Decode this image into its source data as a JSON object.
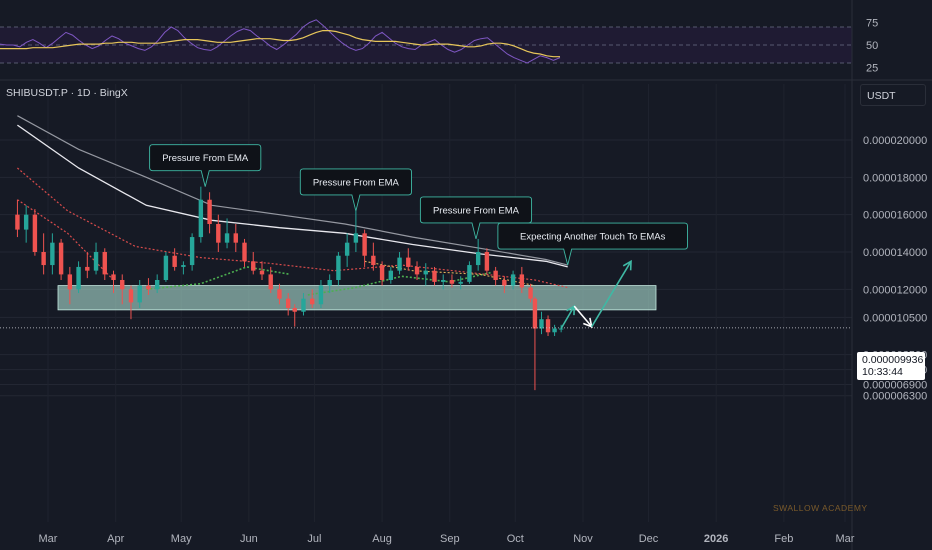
{
  "chart_data": [
    {
      "type": "line",
      "title": "",
      "y_ticks": [
        75,
        50,
        25
      ],
      "ylim": [
        20,
        80
      ],
      "bands": {
        "upper": 70,
        "middle": 50,
        "lower": 30
      },
      "series": [
        {
          "values": [
            51,
            50,
            50,
            48,
            53,
            56,
            52,
            47,
            52,
            58,
            64,
            61,
            55,
            50,
            46,
            49,
            55,
            60,
            57,
            52,
            49,
            46,
            44,
            48,
            55,
            64,
            70,
            66,
            58,
            52,
            47,
            45,
            44,
            48,
            54,
            60,
            65,
            68,
            66,
            60,
            55,
            49,
            45,
            50,
            56,
            62,
            70,
            75,
            78,
            72,
            65,
            58,
            52,
            47,
            44,
            46,
            52,
            60,
            64,
            58,
            52,
            48,
            46,
            45,
            50,
            53,
            56,
            50,
            45,
            42,
            45,
            50,
            55,
            57,
            58,
            52,
            46,
            40,
            36,
            33,
            30,
            34,
            38,
            36,
            33,
            36
          ]
        },
        {
          "values": [
            46,
            46,
            46,
            46,
            46,
            47,
            47,
            47,
            47,
            48,
            49,
            50,
            51,
            51,
            51,
            51,
            52,
            52,
            53,
            53,
            53,
            52,
            52,
            52,
            52,
            53,
            54,
            55,
            56,
            56,
            56,
            55,
            54,
            53,
            53,
            53,
            54,
            55,
            56,
            57,
            57,
            57,
            56,
            55,
            55,
            56,
            58,
            61,
            64,
            66,
            66,
            65,
            63,
            61,
            58,
            56,
            55,
            54,
            54,
            54,
            54,
            53,
            52,
            51,
            50,
            50,
            51,
            51,
            51,
            50,
            49,
            48,
            48,
            49,
            51,
            52,
            52,
            51,
            49,
            46,
            43,
            41,
            40,
            38,
            37,
            37
          ]
        }
      ]
    },
    {
      "type": "candlestick",
      "title": "",
      "y_ticks": [
        "0.000020000",
        "0.000018000",
        "0.000016000",
        "0.000014000",
        "0.000012000",
        "0.000010500",
        "0.000008500",
        "0.000007700",
        "0.000006900",
        "0.000006300"
      ],
      "x_ticks": [
        "Mar",
        "Apr",
        "May",
        "Jun",
        "Jul",
        "Aug",
        "Sep",
        "Oct",
        "Nov",
        "Dec",
        "2026",
        "Feb",
        "Mar"
      ],
      "zone": [
        1.09e-05,
        1.22e-05
      ],
      "last_price": "0.000009936",
      "countdown": "10:33:44",
      "ohlc": [
        {
          "date": "2025-02-15",
          "o": 1.6e-05,
          "h": 1.68e-05,
          "l": 1.48e-05,
          "c": 1.52e-05
        },
        {
          "date": "2025-02-19",
          "o": 1.52e-05,
          "h": 1.65e-05,
          "l": 1.45e-05,
          "c": 1.6e-05
        },
        {
          "date": "2025-02-23",
          "o": 1.6e-05,
          "h": 1.63e-05,
          "l": 1.38e-05,
          "c": 1.4e-05
        },
        {
          "date": "2025-02-27",
          "o": 1.4e-05,
          "h": 1.5e-05,
          "l": 1.28e-05,
          "c": 1.33e-05
        },
        {
          "date": "2025-03-03",
          "o": 1.33e-05,
          "h": 1.5e-05,
          "l": 1.28e-05,
          "c": 1.45e-05
        },
        {
          "date": "2025-03-07",
          "o": 1.45e-05,
          "h": 1.47e-05,
          "l": 1.25e-05,
          "c": 1.28e-05
        },
        {
          "date": "2025-03-11",
          "o": 1.28e-05,
          "h": 1.32e-05,
          "l": 1.12e-05,
          "c": 1.2e-05
        },
        {
          "date": "2025-03-15",
          "o": 1.2e-05,
          "h": 1.35e-05,
          "l": 1.18e-05,
          "c": 1.32e-05
        },
        {
          "date": "2025-03-19",
          "o": 1.32e-05,
          "h": 1.4e-05,
          "l": 1.26e-05,
          "c": 1.3e-05
        },
        {
          "date": "2025-03-23",
          "o": 1.3e-05,
          "h": 1.45e-05,
          "l": 1.28e-05,
          "c": 1.4e-05
        },
        {
          "date": "2025-03-27",
          "o": 1.4e-05,
          "h": 1.42e-05,
          "l": 1.25e-05,
          "c": 1.28e-05
        },
        {
          "date": "2025-03-31",
          "o": 1.28e-05,
          "h": 1.3e-05,
          "l": 1.18e-05,
          "c": 1.25e-05
        },
        {
          "date": "2025-04-04",
          "o": 1.25e-05,
          "h": 1.28e-05,
          "l": 1.12e-05,
          "c": 1.2e-05
        },
        {
          "date": "2025-04-08",
          "o": 1.2e-05,
          "h": 1.22e-05,
          "l": 1.04e-05,
          "c": 1.13e-05
        },
        {
          "date": "2025-04-12",
          "o": 1.13e-05,
          "h": 1.25e-05,
          "l": 1.1e-05,
          "c": 1.22e-05
        },
        {
          "date": "2025-04-16",
          "o": 1.22e-05,
          "h": 1.26e-05,
          "l": 1.17e-05,
          "c": 1.2e-05
        },
        {
          "date": "2025-04-20",
          "o": 1.2e-05,
          "h": 1.28e-05,
          "l": 1.18e-05,
          "c": 1.25e-05
        },
        {
          "date": "2025-04-24",
          "o": 1.25e-05,
          "h": 1.4e-05,
          "l": 1.24e-05,
          "c": 1.38e-05
        },
        {
          "date": "2025-04-28",
          "o": 1.38e-05,
          "h": 1.42e-05,
          "l": 1.3e-05,
          "c": 1.32e-05
        },
        {
          "date": "2025-05-02",
          "o": 1.32e-05,
          "h": 1.35e-05,
          "l": 1.28e-05,
          "c": 1.33e-05
        },
        {
          "date": "2025-05-06",
          "o": 1.33e-05,
          "h": 1.5e-05,
          "l": 1.3e-05,
          "c": 1.48e-05
        },
        {
          "date": "2025-05-10",
          "o": 1.48e-05,
          "h": 1.75e-05,
          "l": 1.45e-05,
          "c": 1.68e-05
        },
        {
          "date": "2025-05-14",
          "o": 1.68e-05,
          "h": 1.72e-05,
          "l": 1.5e-05,
          "c": 1.55e-05
        },
        {
          "date": "2025-05-18",
          "o": 1.55e-05,
          "h": 1.6e-05,
          "l": 1.4e-05,
          "c": 1.45e-05
        },
        {
          "date": "2025-05-22",
          "o": 1.45e-05,
          "h": 1.58e-05,
          "l": 1.42e-05,
          "c": 1.5e-05
        },
        {
          "date": "2025-05-26",
          "o": 1.5e-05,
          "h": 1.55e-05,
          "l": 1.4e-05,
          "c": 1.45e-05
        },
        {
          "date": "2025-05-30",
          "o": 1.45e-05,
          "h": 1.47e-05,
          "l": 1.32e-05,
          "c": 1.35e-05
        },
        {
          "date": "2025-06-03",
          "o": 1.35e-05,
          "h": 1.4e-05,
          "l": 1.28e-05,
          "c": 1.3e-05
        },
        {
          "date": "2025-06-07",
          "o": 1.3e-05,
          "h": 1.35e-05,
          "l": 1.25e-05,
          "c": 1.28e-05
        },
        {
          "date": "2025-06-11",
          "o": 1.28e-05,
          "h": 1.32e-05,
          "l": 1.18e-05,
          "c": 1.2e-05
        },
        {
          "date": "2025-06-15",
          "o": 1.2e-05,
          "h": 1.23e-05,
          "l": 1.12e-05,
          "c": 1.15e-05
        },
        {
          "date": "2025-06-19",
          "o": 1.15e-05,
          "h": 1.18e-05,
          "l": 1.06e-05,
          "c": 1.1e-05
        },
        {
          "date": "2025-06-22",
          "o": 1.1e-05,
          "h": 1.12e-05,
          "l": 1e-05,
          "c": 1.08e-05
        },
        {
          "date": "2025-06-26",
          "o": 1.08e-05,
          "h": 1.18e-05,
          "l": 1.06e-05,
          "c": 1.15e-05
        },
        {
          "date": "2025-06-30",
          "o": 1.15e-05,
          "h": 1.2e-05,
          "l": 1.1e-05,
          "c": 1.12e-05
        },
        {
          "date": "2025-07-04",
          "o": 1.12e-05,
          "h": 1.25e-05,
          "l": 1.1e-05,
          "c": 1.22e-05
        },
        {
          "date": "2025-07-08",
          "o": 1.22e-05,
          "h": 1.28e-05,
          "l": 1.18e-05,
          "c": 1.25e-05
        },
        {
          "date": "2025-07-12",
          "o": 1.25e-05,
          "h": 1.4e-05,
          "l": 1.22e-05,
          "c": 1.38e-05
        },
        {
          "date": "2025-07-16",
          "o": 1.38e-05,
          "h": 1.5e-05,
          "l": 1.32e-05,
          "c": 1.45e-05
        },
        {
          "date": "2025-07-20",
          "o": 1.45e-05,
          "h": 1.62e-05,
          "l": 1.4e-05,
          "c": 1.5e-05
        },
        {
          "date": "2025-07-24",
          "o": 1.5e-05,
          "h": 1.52e-05,
          "l": 1.32e-05,
          "c": 1.38e-05
        },
        {
          "date": "2025-07-28",
          "o": 1.38e-05,
          "h": 1.45e-05,
          "l": 1.3e-05,
          "c": 1.33e-05
        },
        {
          "date": "2025-08-01",
          "o": 1.33e-05,
          "h": 1.35e-05,
          "l": 1.22e-05,
          "c": 1.25e-05
        },
        {
          "date": "2025-08-05",
          "o": 1.25e-05,
          "h": 1.32e-05,
          "l": 1.23e-05,
          "c": 1.3e-05
        },
        {
          "date": "2025-08-09",
          "o": 1.3e-05,
          "h": 1.4e-05,
          "l": 1.28e-05,
          "c": 1.37e-05
        },
        {
          "date": "2025-08-13",
          "o": 1.37e-05,
          "h": 1.42e-05,
          "l": 1.3e-05,
          "c": 1.32e-05
        },
        {
          "date": "2025-08-17",
          "o": 1.32e-05,
          "h": 1.35e-05,
          "l": 1.25e-05,
          "c": 1.28e-05
        },
        {
          "date": "2025-08-21",
          "o": 1.28e-05,
          "h": 1.34e-05,
          "l": 1.22e-05,
          "c": 1.3e-05
        },
        {
          "date": "2025-08-25",
          "o": 1.3e-05,
          "h": 1.32e-05,
          "l": 1.22e-05,
          "c": 1.24e-05
        },
        {
          "date": "2025-08-29",
          "o": 1.24e-05,
          "h": 1.28e-05,
          "l": 1.2e-05,
          "c": 1.25e-05
        },
        {
          "date": "2025-09-02",
          "o": 1.25e-05,
          "h": 1.28e-05,
          "l": 1.21e-05,
          "c": 1.23e-05
        },
        {
          "date": "2025-09-06",
          "o": 1.23e-05,
          "h": 1.27e-05,
          "l": 1.2e-05,
          "c": 1.24e-05
        },
        {
          "date": "2025-09-10",
          "o": 1.24e-05,
          "h": 1.35e-05,
          "l": 1.23e-05,
          "c": 1.33e-05
        },
        {
          "date": "2025-09-14",
          "o": 1.33e-05,
          "h": 1.47e-05,
          "l": 1.3e-05,
          "c": 1.4e-05
        },
        {
          "date": "2025-09-18",
          "o": 1.4e-05,
          "h": 1.42e-05,
          "l": 1.28e-05,
          "c": 1.3e-05
        },
        {
          "date": "2025-09-22",
          "o": 1.3e-05,
          "h": 1.32e-05,
          "l": 1.22e-05,
          "c": 1.25e-05
        },
        {
          "date": "2025-09-26",
          "o": 1.25e-05,
          "h": 1.27e-05,
          "l": 1.18e-05,
          "c": 1.22e-05
        },
        {
          "date": "2025-09-30",
          "o": 1.22e-05,
          "h": 1.3e-05,
          "l": 1.2e-05,
          "c": 1.28e-05
        },
        {
          "date": "2025-10-04",
          "o": 1.28e-05,
          "h": 1.32e-05,
          "l": 1.18e-05,
          "c": 1.21e-05
        },
        {
          "date": "2025-10-08",
          "o": 1.21e-05,
          "h": 1.23e-05,
          "l": 1.13e-05,
          "c": 1.15e-05
        },
        {
          "date": "2025-10-10",
          "o": 1.15e-05,
          "h": 1.16e-05,
          "l": 6.6e-06,
          "c": 9.9e-06
        },
        {
          "date": "2025-10-13",
          "o": 9.9e-06,
          "h": 1.08e-05,
          "l": 9.6e-06,
          "c": 1.04e-05
        },
        {
          "date": "2025-10-16",
          "o": 1.04e-05,
          "h": 1.06e-05,
          "l": 9.5e-06,
          "c": 9.7e-06
        },
        {
          "date": "2025-10-19",
          "o": 9.7e-06,
          "h": 1.01e-05,
          "l": 9.5e-06,
          "c": 9.9e-06
        },
        {
          "date": "2025-10-22",
          "o": 9.9e-06,
          "h": 1.01e-05,
          "l": 9.7e-06,
          "c": 9.9e-06
        }
      ],
      "series": [
        {
          "type": "line",
          "values": [
            {
              "x": "2025-02-15",
              "y": 2.13e-05
            },
            {
              "x": "2025-03-15",
              "y": 1.95e-05
            },
            {
              "x": "2025-04-15",
              "y": 1.8e-05
            },
            {
              "x": "2025-05-15",
              "y": 1.65e-05
            },
            {
              "x": "2025-06-15",
              "y": 1.6e-05
            },
            {
              "x": "2025-07-15",
              "y": 1.55e-05
            },
            {
              "x": "2025-08-15",
              "y": 1.48e-05
            },
            {
              "x": "2025-09-15",
              "y": 1.42e-05
            },
            {
              "x": "2025-10-15",
              "y": 1.36e-05
            },
            {
              "x": "2025-10-25",
              "y": 1.33e-05
            }
          ]
        },
        {
          "type": "line",
          "values": [
            {
              "x": "2025-02-15",
              "y": 2.08e-05
            },
            {
              "x": "2025-03-15",
              "y": 1.85e-05
            },
            {
              "x": "2025-04-15",
              "y": 1.65e-05
            },
            {
              "x": "2025-05-15",
              "y": 1.57e-05
            },
            {
              "x": "2025-06-15",
              "y": 1.53e-05
            },
            {
              "x": "2025-07-15",
              "y": 1.5e-05
            },
            {
              "x": "2025-08-15",
              "y": 1.44e-05
            },
            {
              "x": "2025-09-15",
              "y": 1.39e-05
            },
            {
              "x": "2025-10-15",
              "y": 1.35e-05
            },
            {
              "x": "2025-10-25",
              "y": 1.32e-05
            }
          ]
        },
        {
          "type": "line",
          "values": [
            {
              "x": "2025-02-15",
              "y": 1.85e-05
            },
            {
              "x": "2025-03-10",
              "y": 1.62e-05
            },
            {
              "x": "2025-04-10",
              "y": 1.43e-05
            },
            {
              "x": "2025-05-10",
              "y": 1.37e-05
            },
            {
              "x": "2025-06-10",
              "y": 1.34e-05
            },
            {
              "x": "2025-07-10",
              "y": 1.3e-05
            },
            {
              "x": "2025-08-10",
              "y": 1.33e-05
            },
            {
              "x": "2025-09-10",
              "y": 1.29e-05
            },
            {
              "x": "2025-10-10",
              "y": 1.25e-05
            },
            {
              "x": "2025-10-25",
              "y": 1.21e-05
            }
          ]
        },
        {
          "type": "line",
          "values": [
            {
              "x": "2025-02-15",
              "y": 1.68e-05
            },
            {
              "x": "2025-03-10",
              "y": 1.5e-05
            },
            {
              "x": "2025-03-31",
              "y": 1.25e-05
            }
          ]
        },
        {
          "type": "line",
          "values": [
            {
              "x": "2025-04-15",
              "y": 1.2e-05
            },
            {
              "x": "2025-05-10",
              "y": 1.23e-05
            },
            {
              "x": "2025-05-31",
              "y": 1.32e-05
            },
            {
              "x": "2025-06-20",
              "y": 1.28e-05
            }
          ]
        },
        {
          "type": "line",
          "values": [
            {
              "x": "2025-06-28",
              "y": 1.17e-05
            },
            {
              "x": "2025-07-20",
              "y": 1.21e-05
            },
            {
              "x": "2025-08-10",
              "y": 1.27e-05
            },
            {
              "x": "2025-09-01",
              "y": 1.24e-05
            },
            {
              "x": "2025-09-20",
              "y": 1.29e-05
            }
          ]
        },
        {
          "type": "line",
          "values": [
            {
              "x": "2025-07-24",
              "y": 1.35e-05
            },
            {
              "x": "2025-08-15",
              "y": 1.3e-05
            },
            {
              "x": "2025-09-15",
              "y": 1.28e-05
            },
            {
              "x": "2025-10-10",
              "y": 1.22e-05
            }
          ]
        }
      ],
      "annotations": [
        {
          "text": "Pressure From EMA",
          "x": "2025-05-12",
          "y": 1.75e-05
        },
        {
          "text": "Pressure From EMA",
          "x": "2025-07-20",
          "y": 1.62e-05
        },
        {
          "text": "Pressure From EMA",
          "x": "2025-09-13",
          "y": 1.47e-05
        },
        {
          "text": "Expecting Another Touch To EMAs",
          "x": "2025-10-25",
          "y": 1.33e-05
        }
      ],
      "projection": [
        {
          "x": "2025-10-22",
          "y": 9.9e-06
        },
        {
          "x": "2025-10-28",
          "y": 1.11e-05
        },
        {
          "x": "2025-11-05",
          "y": 1e-05
        },
        {
          "x": "2025-11-23",
          "y": 1.35e-05
        }
      ]
    }
  ],
  "symbol_title": "SHIBUSDT.P · 1D · BingX",
  "currency": "USDT",
  "price_tag": {
    "price": "0.000009936",
    "countdown": "10:33:44"
  },
  "watermark": "SWALLOW ACADEMY",
  "colors": {
    "background": "#161a25",
    "rsi": "#7e57c2",
    "rsi_ma": "#e7c65a",
    "up": "#26a69a",
    "down": "#ef5350",
    "zone": "#a9dccf"
  }
}
